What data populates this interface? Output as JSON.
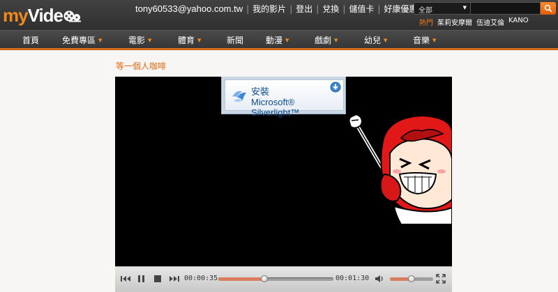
{
  "colors": {
    "brand_orange": "#f08a1e",
    "topbar": "#3a3a3a",
    "accent_bar": "#d97d5f"
  },
  "logo": {
    "my": "my",
    "video": "Vide"
  },
  "header": {
    "email": "tony60533@yahoo.com.tw",
    "links": [
      "我的影片",
      "登出",
      "兌換",
      "儲值卡",
      "好康優惠"
    ]
  },
  "search": {
    "category": "全部",
    "placeholder": "",
    "button_icon": "search-icon"
  },
  "hot": {
    "label": "熱門",
    "items": [
      "茱莉安摩爾",
      "伍迪艾倫",
      "KANO"
    ]
  },
  "nav": [
    {
      "label": "首頁",
      "caret": false
    },
    {
      "label": "免費專區",
      "caret": true
    },
    {
      "label": "電影",
      "caret": true
    },
    {
      "label": "體育",
      "caret": true
    },
    {
      "label": "新聞",
      "caret": false
    },
    {
      "label": "動漫",
      "caret": true
    },
    {
      "label": "戲劇",
      "caret": true
    },
    {
      "label": "幼兒",
      "caret": true
    },
    {
      "label": "音樂",
      "caret": true
    }
  ],
  "video": {
    "title": "等一個人咖啡",
    "silverlight": {
      "install": "安裝",
      "brand": "Microsoft® Silverlight™"
    }
  },
  "controls": {
    "elapsed": "00:00:35",
    "duration": "00:01:30",
    "progress": 0.4,
    "volume": 0.5,
    "icons": [
      "previous-icon",
      "pause-icon",
      "stop-icon",
      "next-icon",
      "volume-icon",
      "fullscreen-icon"
    ]
  }
}
